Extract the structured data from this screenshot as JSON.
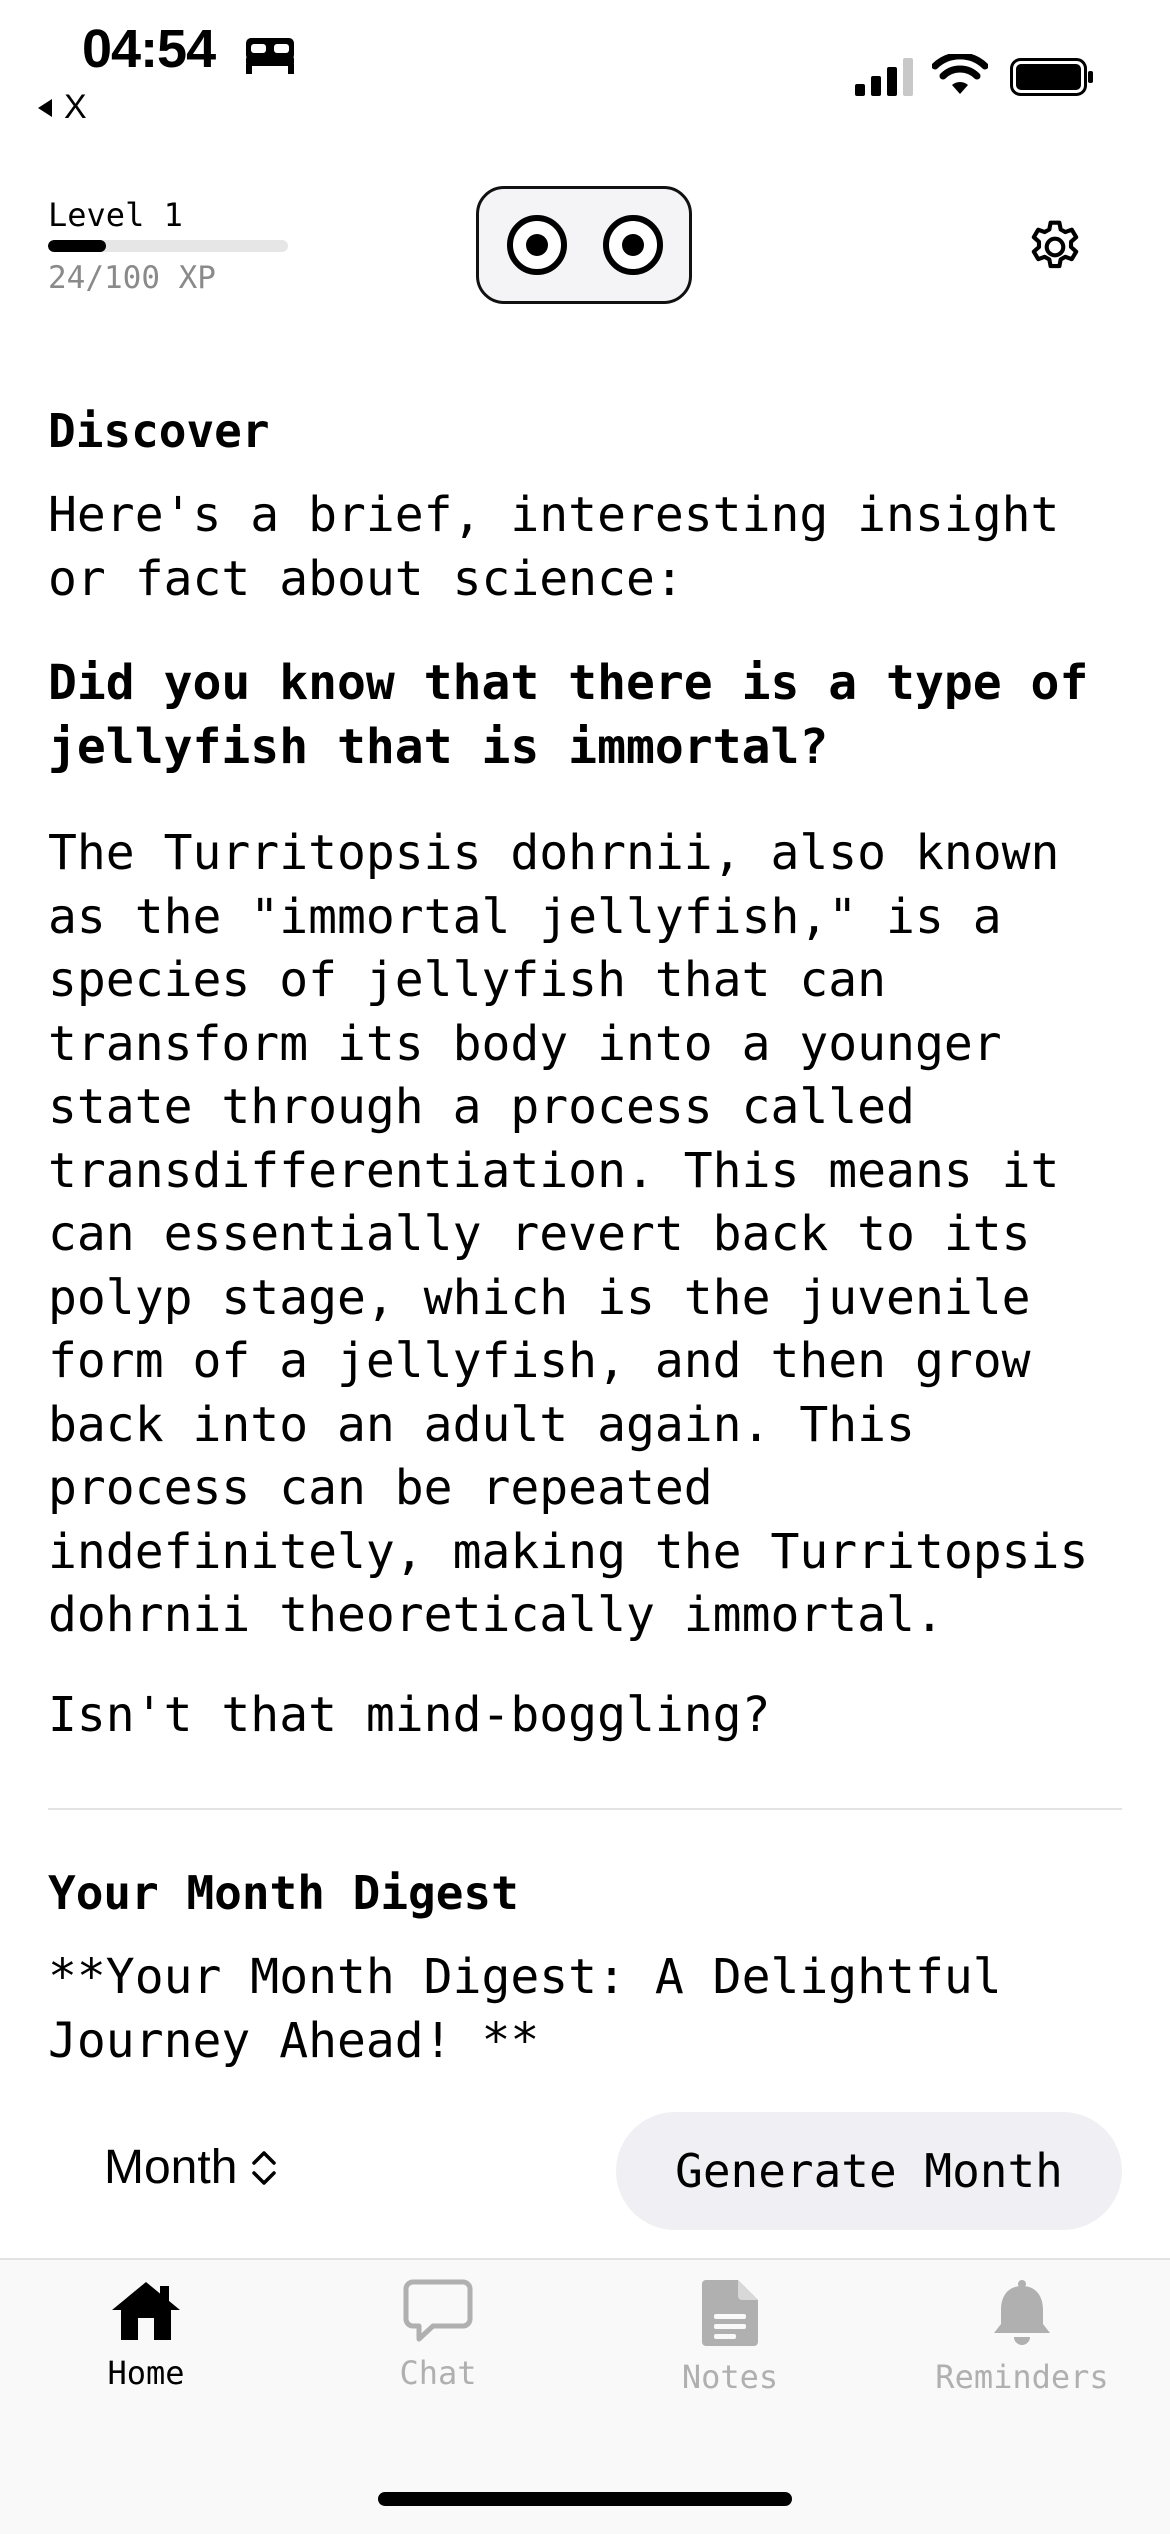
{
  "status": {
    "time": "04:54",
    "back_label": "X"
  },
  "header": {
    "level_label": "Level 1",
    "xp_text": "24/100 XP",
    "xp_progress": 0.24
  },
  "discover": {
    "title": "Discover",
    "intro": "Here's a brief, interesting insight\nor fact about science:",
    "question": "Did you know that there is a type of\njellyfish that is immortal?",
    "body": "The Turritopsis dohrnii, also known\nas the \"immortal jellyfish,\" is a\nspecies of jellyfish that can\ntransform its body into a younger\nstate through a process called\ntransdifferentiation. This means it\ncan essentially revert back to its\npolyp stage, which is the juvenile\nform of a jellyfish, and then grow\nback into an adult again. This\nprocess can be repeated\nindefinitely, making the Turritopsis\ndohrnii theoretically immortal.",
    "closing": "Isn't that mind-boggling?"
  },
  "digest": {
    "title": "Your Month Digest",
    "text": "**Your Month Digest: A Delightful\nJourney Ahead! **"
  },
  "controls": {
    "period_select": "Month",
    "generate_label": "Generate Month"
  },
  "tabs": [
    {
      "label": "Home",
      "icon": "house-icon",
      "active": true
    },
    {
      "label": "Chat",
      "icon": "chat-bubble-icon",
      "active": false
    },
    {
      "label": "Notes",
      "icon": "document-icon",
      "active": false
    },
    {
      "label": "Reminders",
      "icon": "bell-icon",
      "active": false
    }
  ]
}
